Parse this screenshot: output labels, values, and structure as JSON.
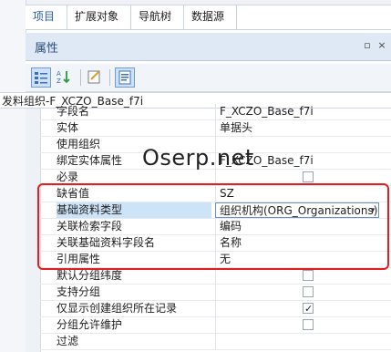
{
  "tabs": [
    "项目",
    "扩展对象",
    "导航树",
    "数据源"
  ],
  "panel": {
    "title": "属性"
  },
  "object_name": "发料组织-F_XCZO_Base_f7i",
  "watermark": "Oserp.net",
  "rows": [
    {
      "name": "字段名",
      "value": "F_XCZO_Base_f7i",
      "type": "text"
    },
    {
      "name": "实体",
      "value": "单据头",
      "type": "text"
    },
    {
      "name": "使用组织",
      "value": "",
      "type": "text"
    },
    {
      "name": "绑定实体属性",
      "value": "F_XCZO_Base_f7i",
      "type": "text"
    },
    {
      "name": "必录",
      "value": "",
      "type": "checkbox",
      "checked": false
    },
    {
      "name": "缺省值",
      "value": "SZ",
      "type": "text"
    },
    {
      "name": "基础资料类型",
      "value": "组织机构(ORG_Organizations)",
      "type": "dropdown",
      "selected": true
    },
    {
      "name": "关联检索字段",
      "value": "编码",
      "type": "text"
    },
    {
      "name": "关联基础资料字段名",
      "value": "名称",
      "type": "text"
    },
    {
      "name": "引用属性",
      "value": "无",
      "type": "text"
    },
    {
      "name": "默认分组纬度",
      "value": "",
      "type": "checkbox",
      "checked": false
    },
    {
      "name": "支持分组",
      "value": "",
      "type": "checkbox",
      "checked": false
    },
    {
      "name": "仅显示创建组织所在记录",
      "value": "",
      "type": "checkbox",
      "checked": true
    },
    {
      "name": "分组允许维护",
      "value": "",
      "type": "checkbox",
      "checked": false
    },
    {
      "name": "过滤",
      "value": "",
      "type": "text"
    }
  ],
  "colors": {
    "accent": "#2a5d9c",
    "highlight_box": "#e02020",
    "selected_row": "#cde3f8"
  },
  "icons": [
    "categorized-icon",
    "sort-az-icon",
    "property-pages-icon",
    "properties-icon"
  ]
}
